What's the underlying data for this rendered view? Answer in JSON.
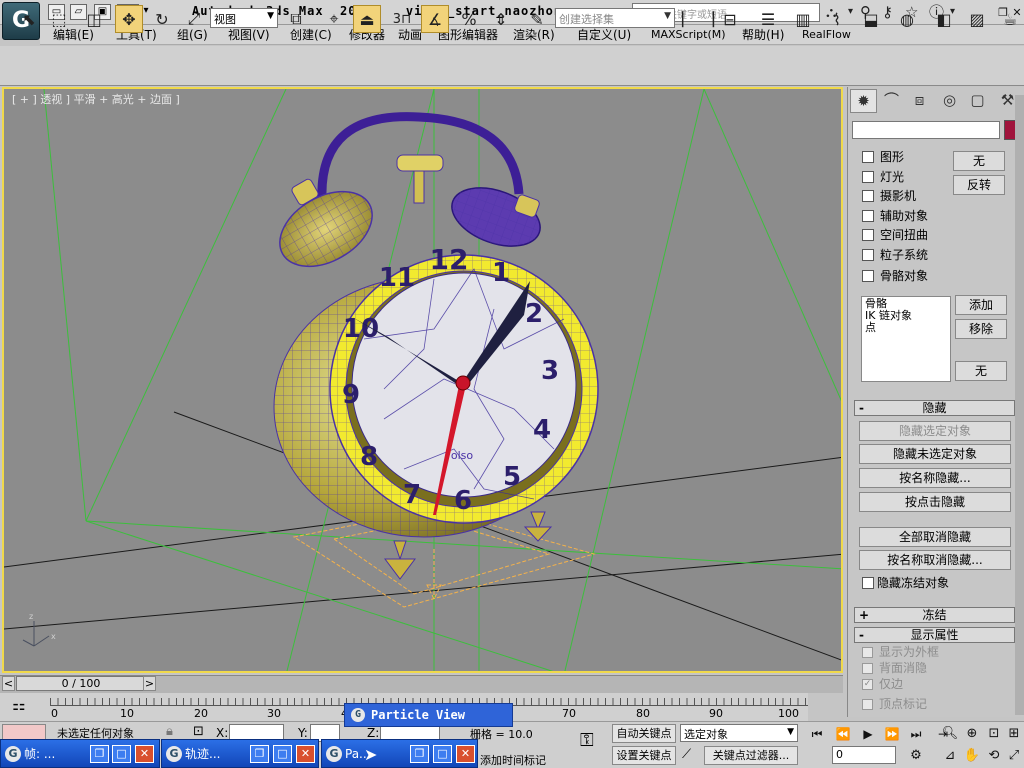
{
  "title": {
    "app": "Autodesk 3ds Max  2010",
    "file": "video_start_naozhong.max",
    "search_placeholder": "键入关键字或短语"
  },
  "menu": [
    "编辑(E)",
    "工具(T)",
    "组(G)",
    "视图(V)",
    "创建(C)",
    "修改器",
    "动画",
    "图形编辑器",
    "渲染(R)",
    "自定义(U)",
    "MAXScript(M)",
    "帮助(H)",
    "RealFlow"
  ],
  "toolbar": {
    "view_select": "视图",
    "named_selection": "创建选择集",
    "snap_label": "3"
  },
  "viewport": {
    "label": "[ + ] 透视 ] 平滑 + 高光 + 边面 ]",
    "clock_numbers": [
      "12",
      "1",
      "2",
      "3",
      "4",
      "5",
      "6",
      "7",
      "8",
      "9",
      "10",
      "11"
    ],
    "brand": "olso",
    "axis_labels": [
      "z",
      "x"
    ]
  },
  "command_panel": {
    "tab_icons": [
      "sun-icon",
      "curve-icon",
      "hierarchy-icon",
      "motion-icon",
      "display-icon",
      "hammer-icon"
    ],
    "object_types": [
      "图形",
      "灯光",
      "摄影机",
      "辅助对象",
      "空间扭曲",
      "粒子系统",
      "骨骼对象"
    ],
    "none_btn": "无",
    "invert_btn": "反转",
    "list_items": [
      "骨骼",
      "IK 链对象",
      "点"
    ],
    "add_btn": "添加",
    "remove_btn": "移除",
    "none_btn2": "无",
    "hide_rollout": {
      "sign": "-",
      "title": "隐藏"
    },
    "hide_buttons": [
      "隐藏选定对象",
      "隐藏未选定对象",
      "按名称隐藏...",
      "按点击隐藏"
    ],
    "unhide_buttons": [
      "全部取消隐藏",
      "按名称取消隐藏..."
    ],
    "hide_frozen": "隐藏冻结对象",
    "freeze_rollout": {
      "sign": "+",
      "title": "冻结"
    },
    "display_rollout": {
      "sign": "-",
      "title": "显示属性"
    },
    "display_props": [
      "显示为外框",
      "背面消隐",
      "仅边",
      "顶点标记"
    ]
  },
  "timeline": {
    "frame_label": "0 / 100",
    "prev": "<",
    "next": ">",
    "ticks": [
      "0",
      "10",
      "20",
      "30",
      "40",
      "50",
      "60",
      "70",
      "80",
      "90",
      "100"
    ]
  },
  "status": {
    "selection": "未选定任何对象",
    "x_label": "X:",
    "y_label": "Y:",
    "z_label": "Z:",
    "grid": "栅格 = 10.0",
    "add_time_tag": "添加时间标记",
    "auto_key": "自动关键点",
    "set_key": "设置关键点",
    "key_mode": "选定对象",
    "key_filters": "关键点过滤器...",
    "frame": "0"
  },
  "popup": {
    "label": "Particle View"
  },
  "taskbar": [
    {
      "label": "帧: ..."
    },
    {
      "label": "轨迹..."
    },
    {
      "label": "Pa..."
    }
  ]
}
